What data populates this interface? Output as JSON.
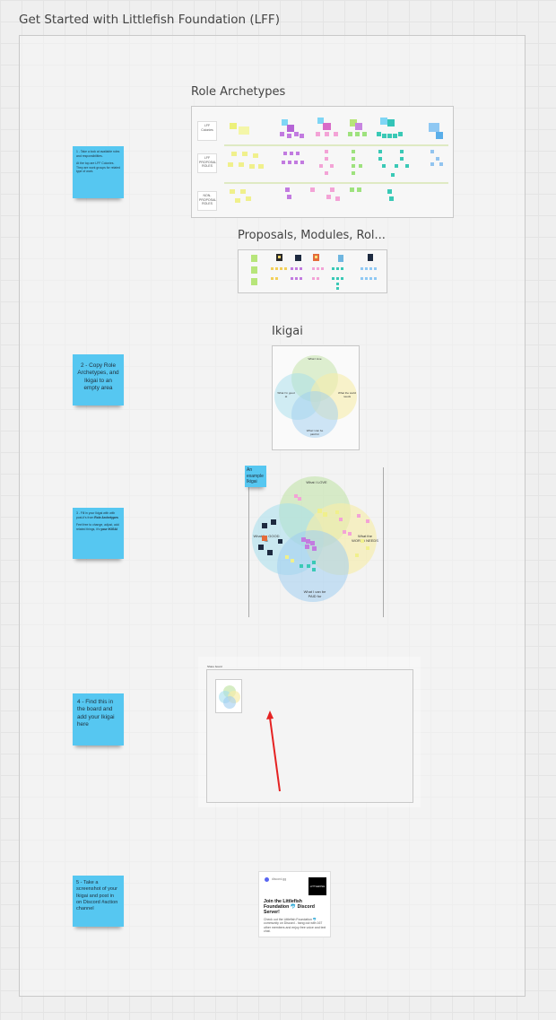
{
  "board": {
    "title": "Get Started with Littlefish Foundation (LFF)"
  },
  "steps": {
    "s1": {
      "line1": "1 - Take a look at available roles and responsibilities.",
      "line2": "At the top are LFF Colonies. They are work groups for related type of work."
    },
    "s2": {
      "text": "2 - Copy Role Archetypes, and Ikigai to an empty area"
    },
    "s3": {
      "line1": "3 - Fill in your Ikigai with with post-it's from",
      "bold1": "Role Archetypes",
      "line2": "Feel free to change, adjust, add related things, it's",
      "bold2": "your IKIGAI"
    },
    "s4": {
      "text": "4 - Find this in the board and add your Ikigai here"
    },
    "s5": {
      "text": "5 - Take a screenshot of your Ikigai and post in on Discord #action channel"
    }
  },
  "role_archetypes": {
    "title": "Role Archetypes",
    "row_labels": [
      "LFF Colonies",
      "LFF PROPOSAL ROLES",
      "NON-PROPOSAL ROLES"
    ]
  },
  "proposals": {
    "title": "Proposals, Modules, Rol..."
  },
  "ikigai": {
    "title": "Ikigai",
    "labels": [
      "What I love",
      "What I'm good at",
      "What I can be paid for",
      "What the world needs"
    ]
  },
  "example": {
    "sticky": "An example Ikigai",
    "labels": [
      "What I LOVE",
      "What I'm GOOD at",
      "What I can be PAID for",
      "What the WORLD NEEDS"
    ]
  },
  "find_board": {
    "label": "Share board"
  },
  "discord": {
    "site": "discord.gg",
    "thumb": "LITTLEFISH",
    "title": "Join the Littlefish Foundation 🐬 Discord Server!",
    "desc": "Check out the Littlefish Foundation 🐬 community on Discord - hang out with 167 other members and enjoy free voice and text chat."
  },
  "colors": {
    "sticky": "#56c7f1",
    "arrow": "#e52222",
    "frame": "#c9c9c9"
  }
}
